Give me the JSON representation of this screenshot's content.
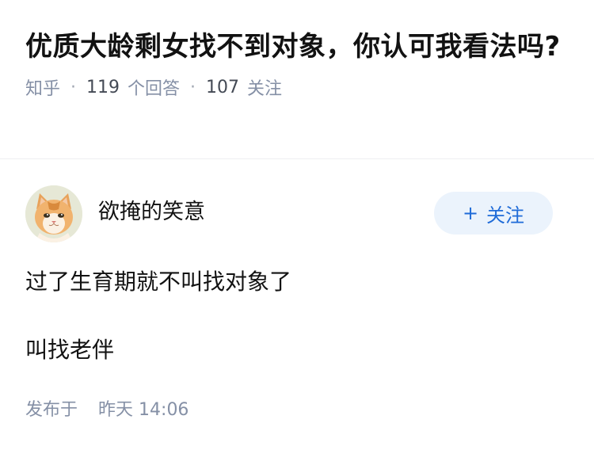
{
  "question": {
    "title": "优质大龄剩女找不到对象，你认可我看法吗?",
    "source": "知乎",
    "answers_count": "119",
    "answers_label": "个回答",
    "followers_count": "107",
    "followers_label": "关注",
    "separator": "·"
  },
  "author": {
    "name": "欲掩的笑意",
    "avatar_icon": "cat-avatar",
    "follow_plus": "+",
    "follow_label": "关注"
  },
  "answer": {
    "paragraphs": [
      "过了生育期就不叫找对象了",
      "叫找老伴"
    ]
  },
  "published": {
    "label": "发布于",
    "date": "昨天",
    "time": "14:06"
  },
  "colors": {
    "meta_gray": "#8590a6",
    "follow_blue": "#1f6bd8",
    "follow_bg": "#ebf3fc",
    "text": "#121212"
  }
}
